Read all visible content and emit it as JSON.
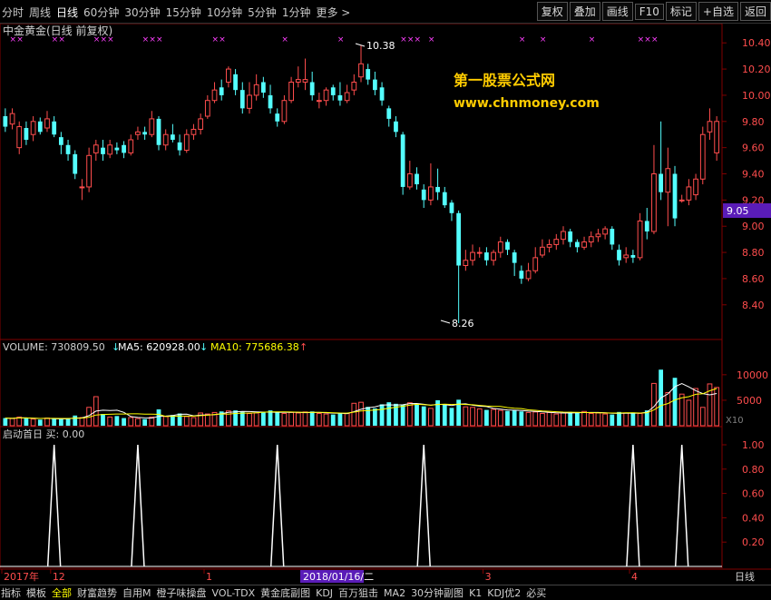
{
  "toolbar": {
    "periods": [
      "分时",
      "周线",
      "日线",
      "60分钟",
      "30分钟",
      "15分钟",
      "10分钟",
      "5分钟",
      "1分钟",
      "更多 >"
    ],
    "active_period": "日线",
    "tools": [
      "复权",
      "叠加",
      "画线",
      "F10",
      "标记",
      "+自选",
      "返回"
    ]
  },
  "main_panel": {
    "title": "中金黄金(日线 前复权)",
    "high_label": "10.38",
    "low_label": "8.26",
    "current_price": "9.05",
    "watermark_line1": "第一股票公式网",
    "watermark_line2": "www.chnmoney.com",
    "price_ticks": [
      "10.40",
      "10.20",
      "10.00",
      "9.80",
      "9.60",
      "9.40",
      "9.20",
      "9.00",
      "8.80",
      "8.60",
      "8.40"
    ]
  },
  "volume_panel": {
    "volume_label": "VOLUME: 730809.50",
    "ma5_label": "MA5: 620928.00",
    "ma10_label": "MA10: 775686.38",
    "ticks": [
      "10000",
      "5000"
    ],
    "unit_label": "X10"
  },
  "signal_panel": {
    "title": "启动首日 买: 0.00",
    "ticks": [
      "1.00",
      "0.80",
      "0.60",
      "0.40",
      "0.20"
    ]
  },
  "time_axis": {
    "labels": [
      "2017年",
      "12",
      "1",
      "2",
      "3",
      "4"
    ],
    "cursor_date": "2018/01/16/二",
    "right_label": "日线"
  },
  "bottom_tabs": {
    "items": [
      "指标",
      "模板",
      "全部",
      "财富趋势",
      "自用M",
      "橙子味操盘",
      "VOL-TDX",
      "黄金底副图",
      "KDJ",
      "百万狙击",
      "MA2",
      "30分钟副图",
      "K1",
      "KDJ优2",
      "必买"
    ],
    "active": "全部"
  },
  "colors": {
    "up": "#ff4d4d",
    "down": "#54ffff",
    "ma5": "#ffffff",
    "ma10": "#ffff00",
    "purple": "#ff40ff",
    "current_price_bg": "#5a1cb8"
  },
  "chart_data": {
    "type": "candlestick",
    "ylim": [
      8.26,
      10.45
    ],
    "volume_ylim": [
      0,
      13000
    ],
    "candles": [
      [
        9.84,
        9.76,
        9.9,
        9.72
      ],
      [
        9.78,
        9.86,
        9.9,
        9.74
      ],
      [
        9.6,
        9.76,
        9.8,
        9.55
      ],
      [
        9.75,
        9.66,
        9.8,
        9.62
      ],
      [
        9.7,
        9.8,
        9.84,
        9.65
      ],
      [
        9.8,
        9.72,
        9.83,
        9.7
      ],
      [
        9.75,
        9.82,
        9.88,
        9.72
      ],
      [
        9.8,
        9.7,
        9.84,
        9.68
      ],
      [
        9.68,
        9.62,
        9.72,
        9.55
      ],
      [
        9.62,
        9.55,
        9.66,
        9.5
      ],
      [
        9.55,
        9.4,
        9.58,
        9.36
      ],
      [
        9.3,
        9.3,
        9.36,
        9.2
      ],
      [
        9.3,
        9.54,
        9.6,
        9.26
      ],
      [
        9.56,
        9.62,
        9.66,
        9.5
      ],
      [
        9.6,
        9.55,
        9.66,
        9.5
      ],
      [
        9.55,
        9.62,
        9.66,
        9.52
      ],
      [
        9.6,
        9.58,
        9.64,
        9.55
      ],
      [
        9.62,
        9.56,
        9.65,
        9.52
      ],
      [
        9.56,
        9.66,
        9.7,
        9.54
      ],
      [
        9.7,
        9.72,
        9.76,
        9.66
      ],
      [
        9.72,
        9.7,
        9.76,
        9.66
      ],
      [
        9.7,
        9.82,
        9.88,
        9.68
      ],
      [
        9.82,
        9.62,
        9.84,
        9.58
      ],
      [
        9.62,
        9.7,
        9.74,
        9.58
      ],
      [
        9.7,
        9.66,
        9.78,
        9.64
      ],
      [
        9.64,
        9.58,
        9.7,
        9.54
      ],
      [
        9.58,
        9.7,
        9.74,
        9.56
      ],
      [
        9.7,
        9.74,
        9.78,
        9.66
      ],
      [
        9.74,
        9.82,
        9.86,
        9.7
      ],
      [
        9.84,
        9.96,
        10.0,
        9.82
      ],
      [
        9.96,
        10.04,
        10.1,
        9.94
      ],
      [
        10.06,
        10.0,
        10.12,
        9.96
      ],
      [
        10.1,
        10.2,
        10.22,
        10.06
      ],
      [
        10.16,
        10.04,
        10.2,
        10.0
      ],
      [
        10.04,
        9.9,
        10.1,
        9.86
      ],
      [
        9.9,
        10.0,
        10.1,
        9.86
      ],
      [
        10.0,
        10.08,
        10.16,
        9.96
      ],
      [
        10.1,
        10.02,
        10.14,
        9.98
      ],
      [
        10.0,
        9.9,
        10.08,
        9.86
      ],
      [
        9.86,
        9.8,
        9.9,
        9.76
      ],
      [
        9.8,
        9.96,
        10.0,
        9.78
      ],
      [
        9.96,
        10.1,
        10.14,
        9.94
      ],
      [
        10.1,
        10.12,
        10.22,
        10.06
      ],
      [
        10.1,
        10.12,
        10.28,
        10.04
      ],
      [
        10.1,
        10.0,
        10.18,
        9.96
      ],
      [
        9.96,
        9.96,
        10.02,
        9.9
      ],
      [
        9.96,
        10.04,
        10.06,
        9.92
      ],
      [
        10.06,
        10.0,
        10.08,
        9.96
      ],
      [
        10.0,
        9.96,
        10.1,
        9.92
      ],
      [
        9.96,
        10.02,
        10.08,
        9.94
      ],
      [
        10.04,
        10.1,
        10.16,
        10.0
      ],
      [
        10.14,
        10.24,
        10.38,
        10.1
      ],
      [
        10.2,
        10.12,
        10.24,
        10.08
      ],
      [
        10.12,
        10.04,
        10.18,
        10.0
      ],
      [
        10.06,
        9.96,
        10.1,
        9.92
      ],
      [
        9.9,
        9.82,
        9.92,
        9.76
      ],
      [
        9.8,
        9.72,
        9.84,
        9.68
      ],
      [
        9.7,
        9.3,
        9.72,
        9.24
      ],
      [
        9.3,
        9.4,
        9.5,
        9.28
      ],
      [
        9.4,
        9.32,
        9.45,
        9.28
      ],
      [
        9.28,
        9.2,
        9.32,
        9.14
      ],
      [
        9.2,
        9.3,
        9.48,
        9.16
      ],
      [
        9.3,
        9.26,
        9.44,
        9.2
      ],
      [
        9.26,
        9.16,
        9.3,
        9.14
      ],
      [
        9.18,
        9.1,
        9.2,
        9.04
      ],
      [
        9.1,
        8.7,
        9.12,
        8.26
      ],
      [
        8.7,
        8.74,
        8.82,
        8.66
      ],
      [
        8.74,
        8.8,
        8.86,
        8.7
      ],
      [
        8.8,
        8.8,
        8.84,
        8.76
      ],
      [
        8.8,
        8.74,
        8.84,
        8.7
      ],
      [
        8.74,
        8.8,
        8.82,
        8.7
      ],
      [
        8.8,
        8.88,
        8.92,
        8.76
      ],
      [
        8.88,
        8.82,
        8.9,
        8.78
      ],
      [
        8.8,
        8.72,
        8.82,
        8.62
      ],
      [
        8.66,
        8.6,
        8.7,
        8.56
      ],
      [
        8.6,
        8.66,
        8.72,
        8.58
      ],
      [
        8.66,
        8.76,
        8.84,
        8.64
      ],
      [
        8.78,
        8.84,
        8.9,
        8.76
      ],
      [
        8.84,
        8.86,
        8.9,
        8.8
      ],
      [
        8.86,
        8.9,
        8.94,
        8.82
      ],
      [
        8.9,
        8.96,
        9.0,
        8.86
      ],
      [
        8.96,
        8.88,
        8.98,
        8.84
      ],
      [
        8.88,
        8.84,
        8.9,
        8.8
      ],
      [
        8.84,
        8.88,
        8.92,
        8.82
      ],
      [
        8.88,
        8.92,
        8.96,
        8.84
      ],
      [
        8.92,
        8.94,
        8.98,
        8.88
      ],
      [
        8.94,
        8.98,
        9.0,
        8.9
      ],
      [
        8.98,
        8.86,
        9.0,
        8.82
      ],
      [
        8.82,
        8.74,
        8.86,
        8.7
      ],
      [
        8.76,
        8.78,
        8.84,
        8.72
      ],
      [
        8.78,
        8.76,
        8.82,
        8.72
      ],
      [
        8.76,
        9.04,
        9.1,
        8.74
      ],
      [
        9.04,
        8.96,
        9.14,
        8.9
      ],
      [
        8.96,
        9.4,
        9.62,
        8.94
      ],
      [
        9.4,
        9.26,
        9.8,
        9.2
      ],
      [
        9.26,
        9.44,
        9.6,
        9.0
      ],
      [
        9.4,
        9.06,
        9.46,
        9.0
      ],
      [
        9.2,
        9.2,
        9.24,
        9.18
      ],
      [
        9.2,
        9.3,
        9.36,
        9.16
      ],
      [
        9.24,
        9.36,
        9.4,
        9.2
      ],
      [
        9.36,
        9.7,
        9.76,
        9.32
      ],
      [
        9.72,
        9.8,
        9.9,
        9.66
      ],
      [
        9.56,
        9.8,
        9.84,
        9.5
      ]
    ],
    "volumes": [
      1500,
      1400,
      1700,
      1500,
      1300,
      1200,
      1500,
      1400,
      1300,
      1400,
      2000,
      1600,
      3600,
      5700,
      2300,
      1700,
      1900,
      1500,
      1600,
      1400,
      1300,
      1700,
      3200,
      1800,
      2100,
      2400,
      1800,
      1600,
      2500,
      2300,
      2600,
      2800,
      2900,
      3000,
      2800,
      2400,
      2500,
      2700,
      3000,
      2600,
      2400,
      2600,
      2500,
      2700,
      2800,
      2400,
      2300,
      2200,
      2500,
      2400,
      4400,
      4600,
      3700,
      3400,
      4200,
      4600,
      4300,
      4100,
      4500,
      4300,
      3800,
      3400,
      5000,
      4200,
      3500,
      5100,
      3700,
      3600,
      3300,
      3100,
      3200,
      3000,
      2900,
      3000,
      2800,
      2600,
      2700,
      2400,
      2600,
      2300,
      2500,
      2700,
      2600,
      2800,
      2400,
      2500,
      2300,
      2200,
      2700,
      2500,
      2600,
      2400,
      3000,
      8300,
      11000,
      6500,
      9400,
      6200,
      5000,
      7300,
      3600,
      8200,
      7500
    ],
    "signal_indices": [
      7,
      19,
      39,
      60,
      90,
      97
    ]
  }
}
